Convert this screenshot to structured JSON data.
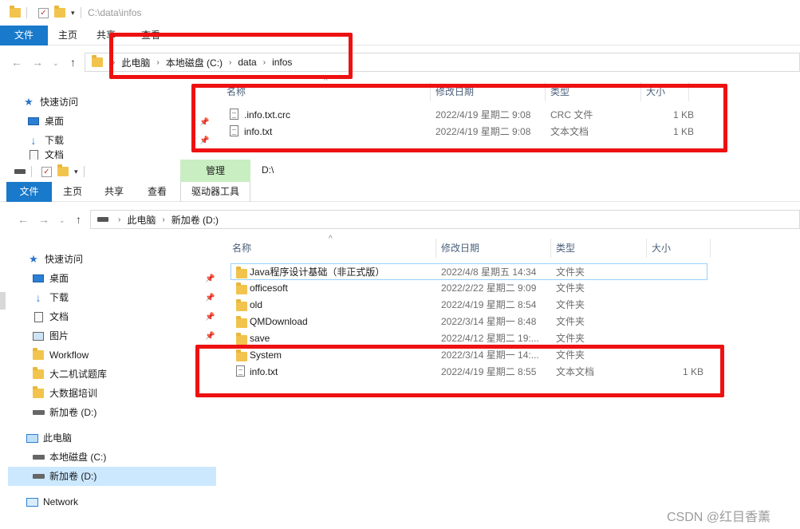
{
  "top_window": {
    "title": "C:\\data\\infos",
    "ribbon_tabs": [
      "文件",
      "主页",
      "共享",
      "查看"
    ],
    "breadcrumb": [
      "此电脑",
      "本地磁盘 (C:)",
      "data",
      "infos"
    ],
    "columns": [
      "名称",
      "修改日期",
      "类型",
      "大小"
    ],
    "sidebar": {
      "quick_access": "快速访问",
      "desktop": "桌面",
      "downloads": "下载",
      "documents_partial": "文档"
    },
    "files": [
      {
        "name": ".info.txt.crc",
        "date": "2022/4/19 星期二 9:08",
        "type": "CRC 文件",
        "size": "1 KB"
      },
      {
        "name": "info.txt",
        "date": "2022/4/19 星期二 9:08",
        "type": "文本文档",
        "size": "1 KB"
      }
    ]
  },
  "bottom_window": {
    "title": "D:\\",
    "context_tab": "管理",
    "context_subtab": "驱动器工具",
    "ribbon_tabs": [
      "文件",
      "主页",
      "共享",
      "查看"
    ],
    "breadcrumb": [
      "此电脑",
      "新加卷 (D:)"
    ],
    "columns": [
      "名称",
      "修改日期",
      "类型",
      "大小"
    ],
    "sidebar": {
      "quick_access": "快速访问",
      "items": [
        "桌面",
        "下载",
        "文档",
        "图片",
        "Workflow",
        "大二机试题库",
        "大数据培训",
        "新加卷 (D:)"
      ],
      "this_pc": "此电脑",
      "drives": [
        "本地磁盘 (C:)",
        "新加卷 (D:)"
      ],
      "network": "Network"
    },
    "files": [
      {
        "name": "Java程序设计基础（非正式版）",
        "date": "2022/4/8 星期五 14:34",
        "type": "文件夹",
        "size": "",
        "kind": "folder"
      },
      {
        "name": "officesoft",
        "date": "2022/2/22 星期二 9:09",
        "type": "文件夹",
        "size": "",
        "kind": "folder"
      },
      {
        "name": "old",
        "date": "2022/4/19 星期二 8:54",
        "type": "文件夹",
        "size": "",
        "kind": "folder"
      },
      {
        "name": "QMDownload",
        "date": "2022/3/14 星期一 8:48",
        "type": "文件夹",
        "size": "",
        "kind": "folder"
      },
      {
        "name": "save",
        "date": "2022/4/12 星期二 19:...",
        "type": "文件夹",
        "size": "",
        "kind": "folder"
      },
      {
        "name": "System",
        "date": "2022/3/14 星期一 14:...",
        "type": "文件夹",
        "size": "",
        "kind": "folder"
      },
      {
        "name": "info.txt",
        "date": "2022/4/19 星期二 8:55",
        "type": "文本文档",
        "size": "1 KB",
        "kind": "file"
      }
    ]
  },
  "watermark": "CSDN @红目香薰",
  "colors": {
    "file_tab": "#1979ca",
    "manage_tab": "#c9eec2",
    "highlight": "#ee1111",
    "selection": "#cce8ff"
  }
}
